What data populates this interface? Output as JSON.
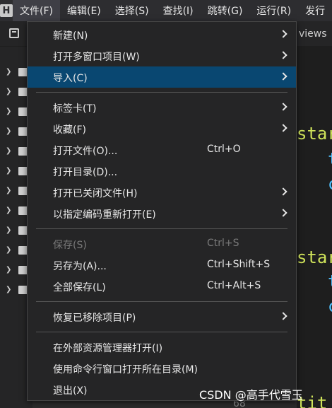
{
  "menubar": {
    "logo": "H",
    "items": [
      "文件(F)",
      "编辑(E)",
      "选择(S)",
      "查找(I)",
      "跳转(G)",
      "运行(R)",
      "发行"
    ]
  },
  "toolbar": {
    "tab_partial": "views"
  },
  "editor": {
    "code_lines": [
      "star",
      "t",
      "c",
      "star",
      "t",
      "c"
    ],
    "line_number": "68",
    "bottom_code": "tit"
  },
  "file_menu": {
    "items": [
      {
        "label": "新建(N)",
        "shortcut": "",
        "submenu": true
      },
      {
        "label": "打开多窗口项目(W)",
        "shortcut": "",
        "submenu": true
      },
      {
        "label": "导入(C)",
        "shortcut": "",
        "submenu": true,
        "selected": true
      },
      {
        "label": "标签卡(T)",
        "shortcut": "",
        "submenu": true
      },
      {
        "label": "收藏(F)",
        "shortcut": "",
        "submenu": true
      },
      {
        "label": "打开文件(O)...",
        "shortcut": "Ctrl+O",
        "submenu": false
      },
      {
        "label": "打开目录(D)...",
        "shortcut": "",
        "submenu": false
      },
      {
        "label": "打开已关闭文件(H)",
        "shortcut": "",
        "submenu": true
      },
      {
        "label": "以指定编码重新打开(E)",
        "shortcut": "",
        "submenu": true
      },
      {
        "label": "保存(S)",
        "shortcut": "Ctrl+S",
        "submenu": false,
        "disabled": true
      },
      {
        "label": "另存为(A)...",
        "shortcut": "Ctrl+Shift+S",
        "submenu": false
      },
      {
        "label": "全部保存(L)",
        "shortcut": "Ctrl+Alt+S",
        "submenu": false
      },
      {
        "label": "恢复已移除项目(P)",
        "shortcut": "",
        "submenu": true
      },
      {
        "label": "在外部资源管理器打开(I)",
        "shortcut": "",
        "submenu": false
      },
      {
        "label": "使用命令行窗口打开所在目录(M)",
        "shortcut": "",
        "submenu": false
      },
      {
        "label": "退出(X)",
        "shortcut": "",
        "submenu": false
      }
    ]
  },
  "watermark": "CSDN @高手代雪玉"
}
